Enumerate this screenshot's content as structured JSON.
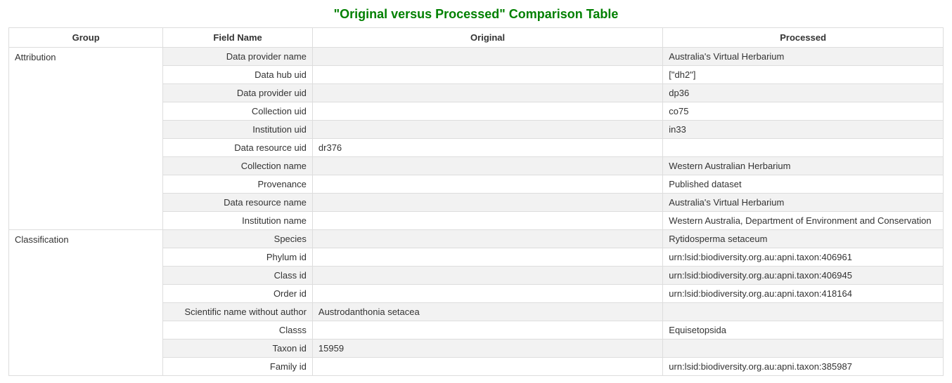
{
  "title": "\"Original versus Processed\" Comparison Table",
  "headers": {
    "group": "Group",
    "field": "Field Name",
    "original": "Original",
    "processed": "Processed"
  },
  "groups": [
    {
      "name": "Attribution",
      "rows": [
        {
          "field": "Data provider name",
          "original": "",
          "processed": "Australia's Virtual Herbarium",
          "shaded": true
        },
        {
          "field": "Data hub uid",
          "original": "",
          "processed": "[\"dh2\"]",
          "shaded": false
        },
        {
          "field": "Data provider uid",
          "original": "",
          "processed": "dp36",
          "shaded": true
        },
        {
          "field": "Collection uid",
          "original": "",
          "processed": "co75",
          "shaded": false
        },
        {
          "field": "Institution uid",
          "original": "",
          "processed": "in33",
          "shaded": true
        },
        {
          "field": "Data resource uid",
          "original": "dr376",
          "processed": "",
          "shaded": false
        },
        {
          "field": "Collection name",
          "original": "",
          "processed": "Western Australian Herbarium",
          "shaded": true
        },
        {
          "field": "Provenance",
          "original": "",
          "processed": "Published dataset",
          "shaded": false
        },
        {
          "field": "Data resource name",
          "original": "",
          "processed": "Australia's Virtual Herbarium",
          "shaded": true
        },
        {
          "field": "Institution name",
          "original": "",
          "processed": "Western Australia, Department of Environment and Conservation",
          "shaded": false
        }
      ]
    },
    {
      "name": "Classification",
      "rows": [
        {
          "field": "Species",
          "original": "",
          "processed": "Rytidosperma setaceum",
          "shaded": true
        },
        {
          "field": "Phylum id",
          "original": "",
          "processed": "urn:lsid:biodiversity.org.au:apni.taxon:406961",
          "shaded": false
        },
        {
          "field": "Class id",
          "original": "",
          "processed": "urn:lsid:biodiversity.org.au:apni.taxon:406945",
          "shaded": true
        },
        {
          "field": "Order id",
          "original": "",
          "processed": "urn:lsid:biodiversity.org.au:apni.taxon:418164",
          "shaded": false
        },
        {
          "field": "Scientific name without author",
          "original": "Austrodanthonia setacea",
          "processed": "",
          "shaded": true
        },
        {
          "field": "Classs",
          "original": "",
          "processed": "Equisetopsida",
          "shaded": false
        },
        {
          "field": "Taxon id",
          "original": "15959",
          "processed": "",
          "shaded": true
        },
        {
          "field": "Family id",
          "original": "",
          "processed": "urn:lsid:biodiversity.org.au:apni.taxon:385987",
          "shaded": false
        }
      ]
    }
  ]
}
